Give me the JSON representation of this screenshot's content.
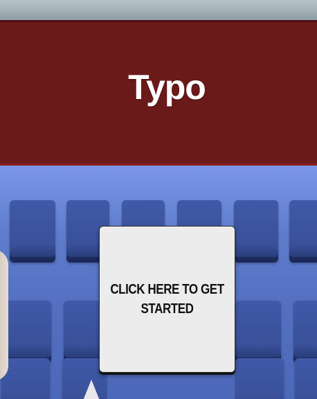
{
  "header": {
    "title": "Typo",
    "background_color": "#6b1a1a"
  },
  "hero": {
    "background": "keyboard-photo",
    "cta_label": "CLICK HERE TO GET STARTED"
  }
}
